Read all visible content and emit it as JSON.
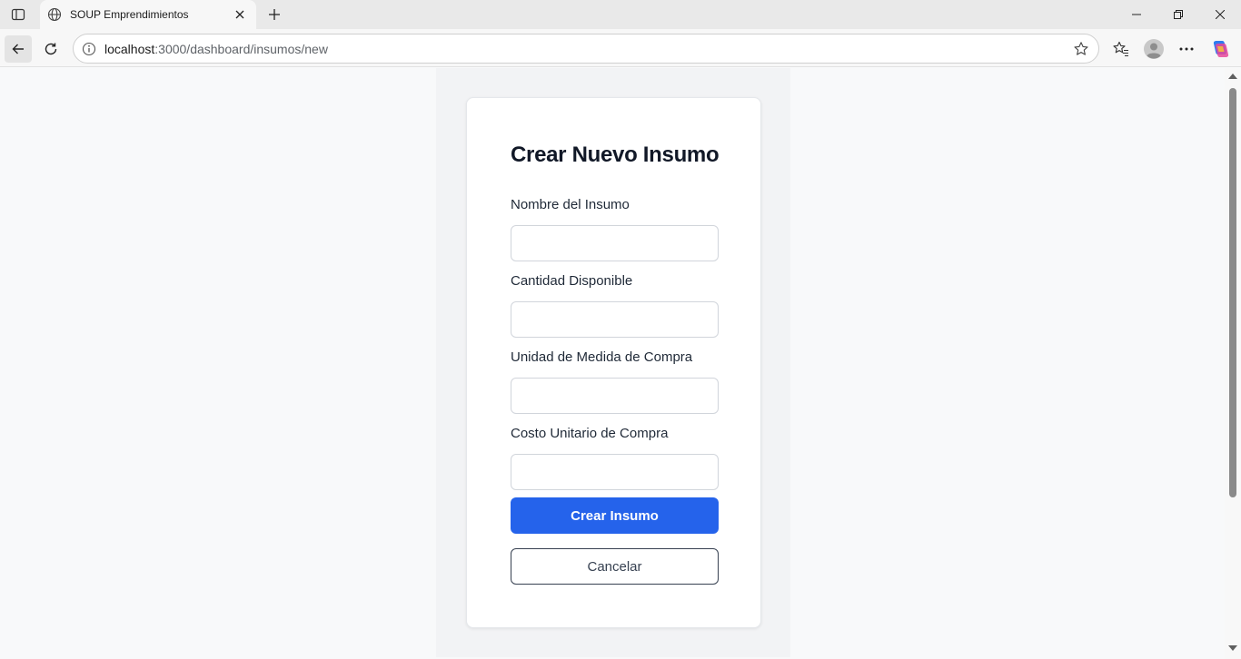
{
  "browser": {
    "tab_title": "SOUP Emprendimientos",
    "url_host": "localhost",
    "url_rest": ":3000/dashboard/insumos/new",
    "icons": {
      "tab_actions": "tab-actions-icon",
      "favicon": "globe-icon",
      "tab_close": "close-icon",
      "new_tab": "plus-icon",
      "back": "back-arrow-icon",
      "reload": "reload-icon",
      "site_info": "info-icon",
      "favorite": "star-icon",
      "favorites": "favorites-icon",
      "profile": "profile-icon",
      "more": "more-icon",
      "copilot": "copilot-icon"
    }
  },
  "form": {
    "title": "Crear Nuevo Insumo",
    "fields": [
      {
        "label": "Nombre del Insumo",
        "value": ""
      },
      {
        "label": "Cantidad Disponible",
        "value": ""
      },
      {
        "label": "Unidad de Medida de Compra",
        "value": ""
      },
      {
        "label": "Costo Unitario de Compra",
        "value": ""
      }
    ],
    "submit_label": "Crear Insumo",
    "cancel_label": "Cancelar"
  },
  "colors": {
    "primary": "#2563eb",
    "page_bg": "#f8f9fa",
    "card_bg": "#ffffff",
    "title_text": "#111827"
  }
}
